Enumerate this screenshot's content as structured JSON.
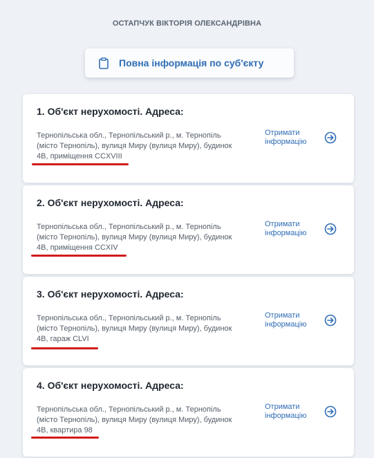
{
  "subject_name": "ОСТАПЧУК ВІКТОРІЯ ОЛЕКСАНДРІВНА",
  "full_info_button": {
    "label": "Повна інформація по суб'єкту",
    "icon": "clipboard-icon"
  },
  "accent_color": "#2f6db5",
  "underline_color": "#d21a1a",
  "properties": [
    {
      "title": "1. Об'єкт нерухомості. Адреса:",
      "address_lines": [
        "Тернопільська обл., Тернопільський р., м. Тернопіль",
        "(місто Тернопіль), вулиця Миру (вулиця Миру), будинок",
        "4В, приміщення CCXVIII"
      ],
      "link_lines": [
        "Отримати",
        "інформацію"
      ],
      "icon": "arrow-right-circle-icon"
    },
    {
      "title": "2. Об'єкт нерухомості. Адреса:",
      "address_lines": [
        "Тернопільська обл., Тернопільський р., м. Тернопіль",
        "(місто Тернопіль), вулиця Миру (вулиця Миру), будинок",
        "4В, приміщення CCXIV"
      ],
      "link_lines": [
        "Отримати",
        "інформацію"
      ],
      "icon": "arrow-right-circle-icon"
    },
    {
      "title": "3. Об'єкт нерухомості. Адреса:",
      "address_lines": [
        "Тернопільська обл., Тернопільський р., м. Тернопіль",
        "(місто Тернопіль), вулиця Миру (вулиця Миру), будинок",
        "4В, гараж CLVI"
      ],
      "link_lines": [
        "Отримати",
        "інформацію"
      ],
      "icon": "arrow-right-circle-icon"
    },
    {
      "title": "4. Об'єкт нерухомості. Адреса:",
      "address_lines": [
        "Тернопільська обл., Тернопільський р., м. Тернопіль",
        "(місто Тернопіль), вулиця Миру (вулиця Миру), будинок",
        "4В, квартира 98"
      ],
      "link_lines": [
        "Отримати",
        "інформацію"
      ],
      "icon": "arrow-right-circle-icon"
    }
  ]
}
